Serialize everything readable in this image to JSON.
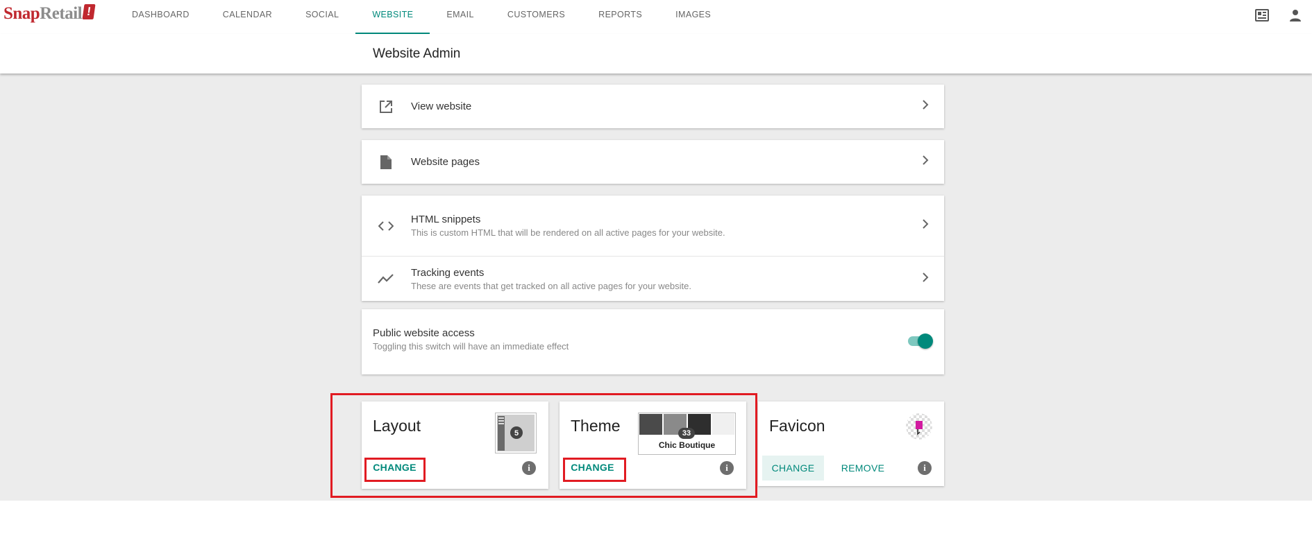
{
  "brand": {
    "name_part1": "Snap",
    "name_part2": "Retail",
    "tag": "!"
  },
  "nav": {
    "items": [
      {
        "label": "DASHBOARD",
        "id": "dashboard"
      },
      {
        "label": "CALENDAR",
        "id": "calendar"
      },
      {
        "label": "SOCIAL",
        "id": "social"
      },
      {
        "label": "WEBSITE",
        "id": "website",
        "active": true
      },
      {
        "label": "EMAIL",
        "id": "email"
      },
      {
        "label": "CUSTOMERS",
        "id": "customers"
      },
      {
        "label": "REPORTS",
        "id": "reports"
      },
      {
        "label": "IMAGES",
        "id": "images"
      }
    ],
    "icons": [
      "newspaper-icon",
      "person-icon"
    ]
  },
  "page": {
    "title": "Website Admin"
  },
  "rows": {
    "view_website": {
      "label": "View website",
      "icon": "open-in-new-icon"
    },
    "website_pages": {
      "label": "Website pages",
      "icon": "file-icon"
    },
    "html_snippets": {
      "label": "HTML snippets",
      "description": "This is custom HTML that will be rendered on all active pages for your website.",
      "icon": "code-icon"
    },
    "tracking_events": {
      "label": "Tracking events",
      "description": "These are events that get tracked on all active pages for your website.",
      "icon": "trending-icon"
    }
  },
  "public_access": {
    "label": "Public website access",
    "description": "Toggling this switch will have an immediate effect",
    "enabled": true
  },
  "layout": {
    "title": "Layout",
    "badge": "5",
    "change_label": "CHANGE"
  },
  "theme": {
    "title": "Theme",
    "badge": "33",
    "theme_name": "Chic Boutique",
    "change_label": "CHANGE",
    "swatches": [
      "#4a4a4a",
      "#8a8a8a",
      "#2e2e2e",
      "#f0f0f0"
    ]
  },
  "favicon": {
    "title": "Favicon",
    "change_label": "CHANGE",
    "remove_label": "REMOVE"
  },
  "colors": {
    "accent": "#00897b",
    "brand_red": "#c0282f",
    "highlight": "#e11b22"
  }
}
